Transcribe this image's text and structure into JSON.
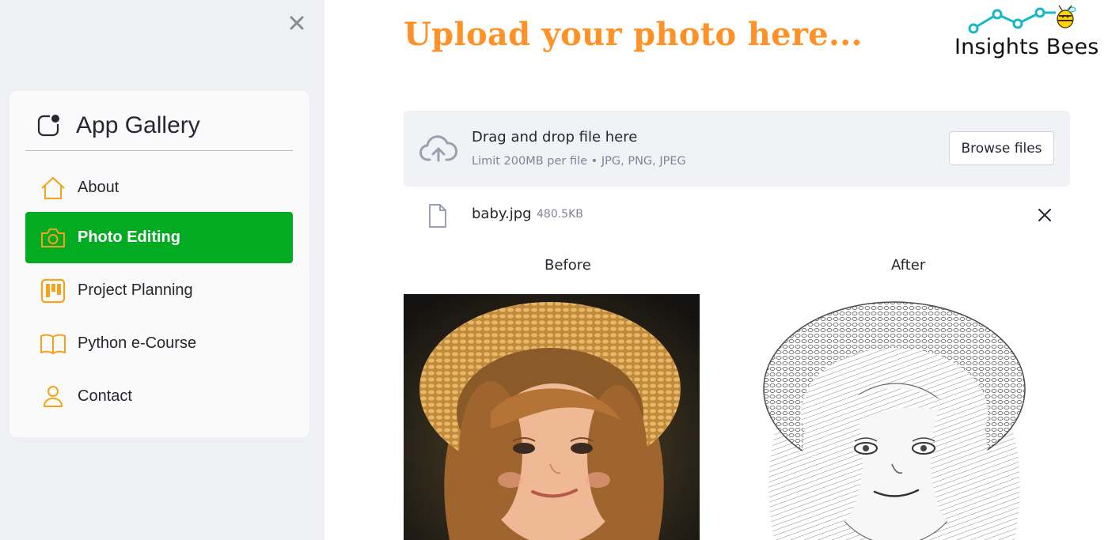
{
  "sidebar": {
    "close_icon": "close-icon",
    "menu_title": "App Gallery",
    "menu_icon": "app-indicator-icon",
    "items": [
      {
        "label": "About",
        "icon": "house-icon",
        "active": false
      },
      {
        "label": "Photo Editing",
        "icon": "camera-icon",
        "active": true
      },
      {
        "label": "Project Planning",
        "icon": "kanban-icon",
        "active": false
      },
      {
        "label": "Python e-Course",
        "icon": "book-icon",
        "active": false
      },
      {
        "label": "Contact",
        "icon": "person-icon",
        "active": false
      }
    ]
  },
  "main": {
    "title": "Upload your photo here...",
    "brand": "Insights Bees",
    "uploader": {
      "drop_label": "Drag and drop file here",
      "limit_text": "Limit 200MB per file • JPG, PNG, JPEG",
      "browse_label": "Browse files"
    },
    "file": {
      "name": "baby.jpg",
      "size": "480.5KB"
    },
    "captions": {
      "before": "Before",
      "after": "After"
    }
  },
  "colors": {
    "accent_orange": "#ff9126",
    "active_green": "#02ab21",
    "sidebar_bg": "#eff0f4",
    "dropzone_bg": "#f0f2f6",
    "icon_orange": "#f5a31a"
  }
}
